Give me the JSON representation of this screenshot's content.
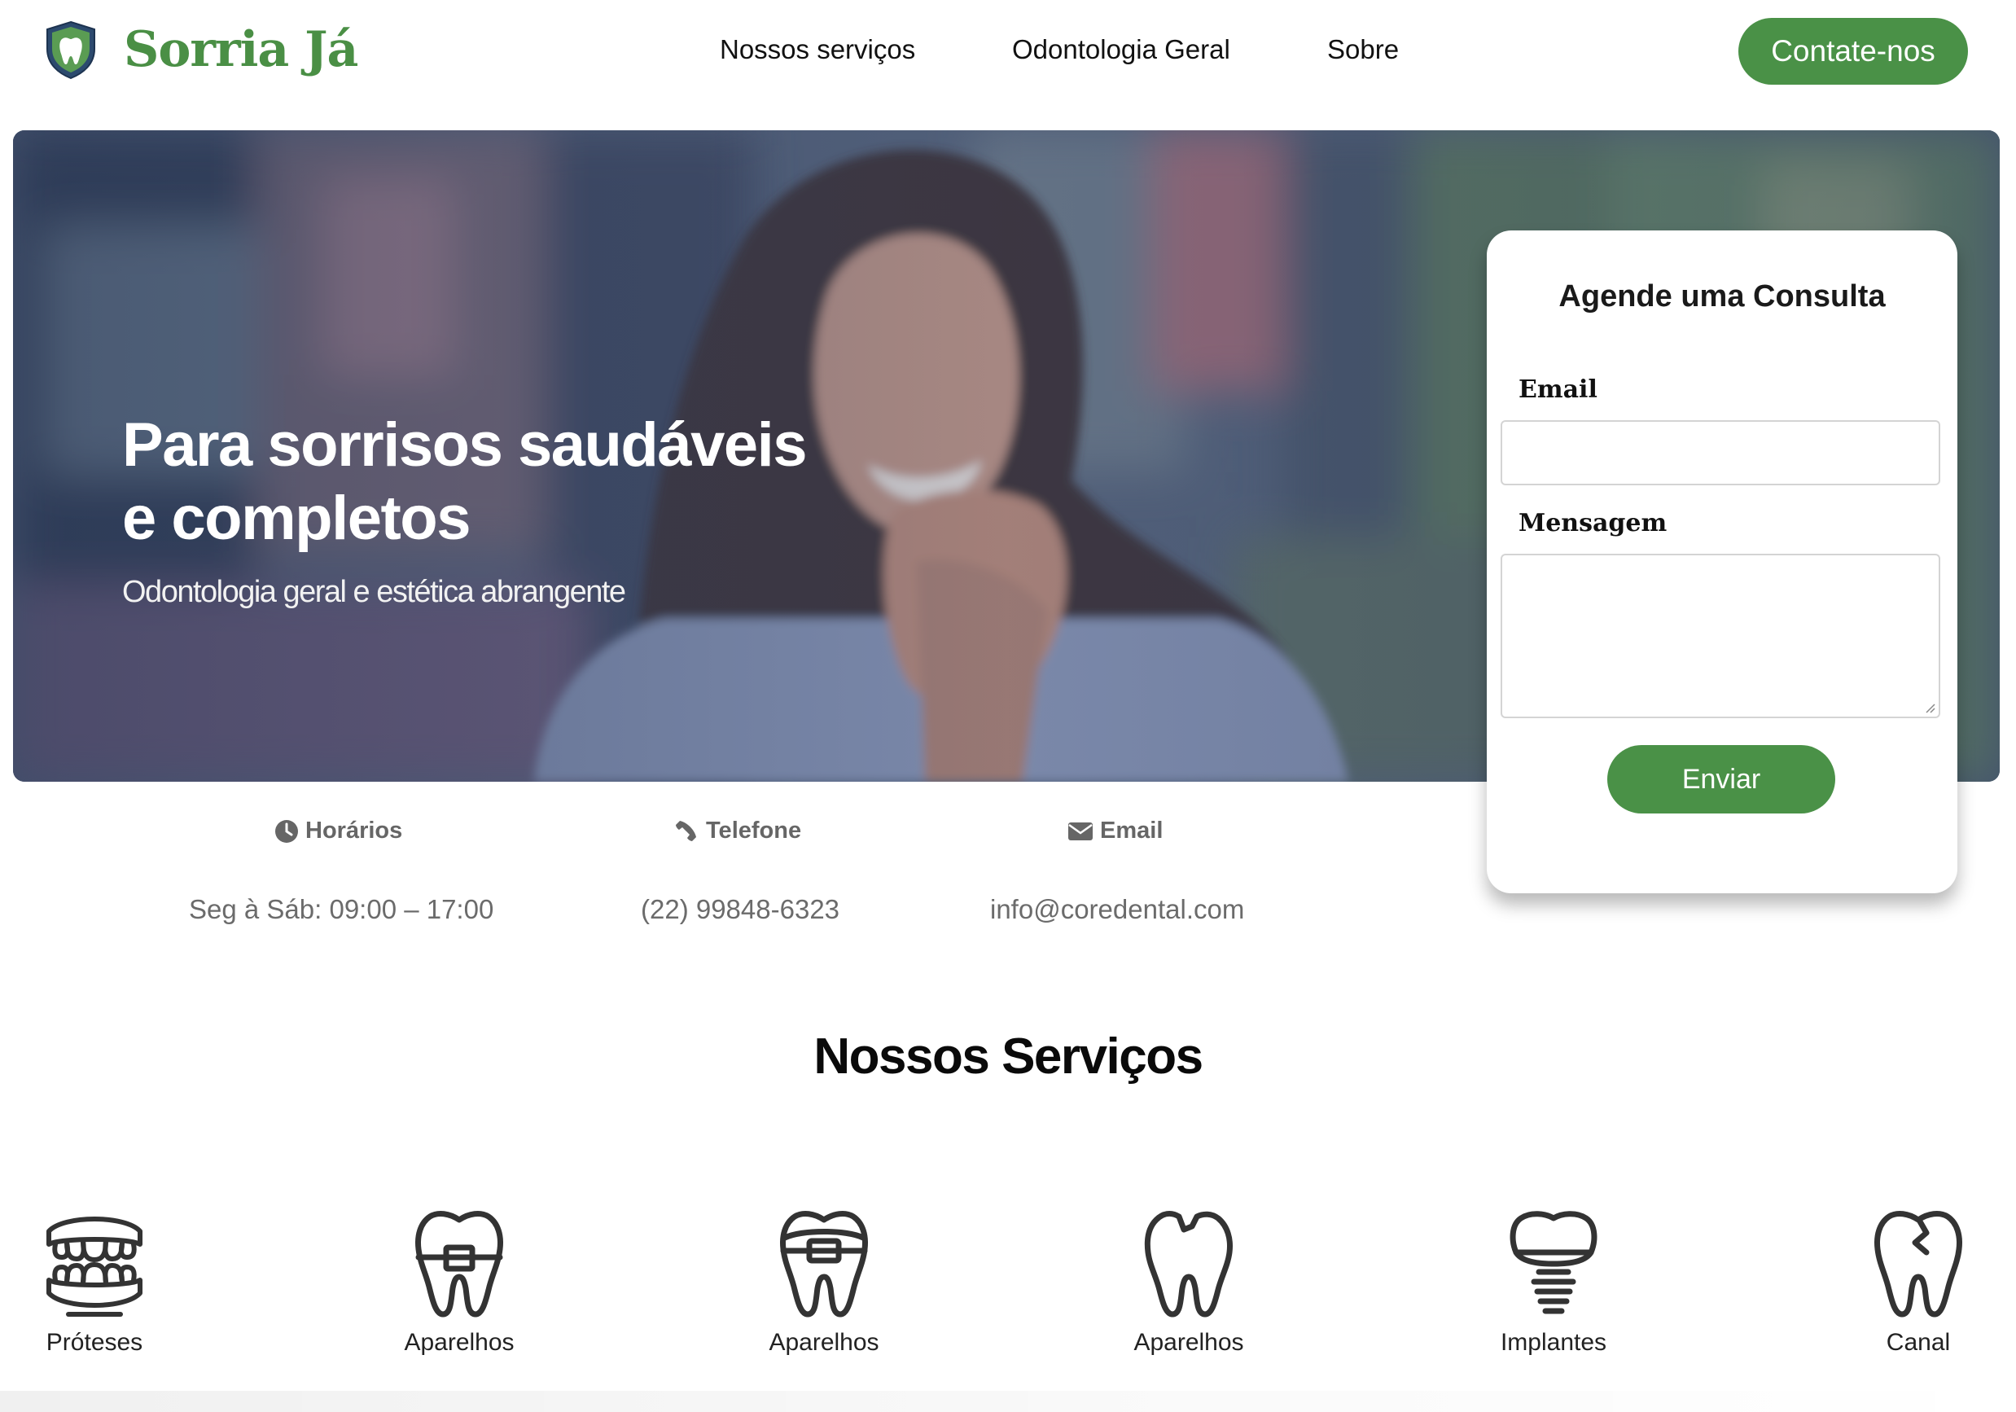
{
  "brand": {
    "name": "Sorria Já",
    "color": "#4a8f45",
    "icon": "tooth-shield-icon"
  },
  "nav": {
    "links": [
      "Nossos serviços",
      "Odontologia Geral",
      "Sobre"
    ],
    "cta": "Contate-nos"
  },
  "hero": {
    "title": "Para sorrisos saudáveis e completos",
    "subtitle": "Odontologia geral e estética abrangente"
  },
  "form": {
    "title": "Agende uma Consulta",
    "email_label": "Email",
    "email_value": "",
    "message_label": "Mensagem",
    "message_value": "",
    "submit": "Enviar"
  },
  "info": [
    {
      "icon": "clock-icon",
      "title": "Horários",
      "value": "Seg à Sáb: 09:00 – 17:00"
    },
    {
      "icon": "phone-icon",
      "title": "Telefone",
      "value": "(22) 99848-6323"
    },
    {
      "icon": "envelope-icon",
      "title": "Email",
      "value": "info@coredental.com"
    }
  ],
  "services": {
    "title": "Nossos Serviços",
    "items": [
      {
        "icon": "dentures-icon",
        "label": "Próteses"
      },
      {
        "icon": "tooth-braces-icon",
        "label": "Aparelhos"
      },
      {
        "icon": "tooth-braces-icon",
        "label": "Aparelhos"
      },
      {
        "icon": "chipped-tooth-icon",
        "label": "Aparelhos"
      },
      {
        "icon": "dental-implant-icon",
        "label": "Implantes"
      },
      {
        "icon": "cracked-tooth-icon",
        "label": "Canal"
      }
    ]
  },
  "colors": {
    "accent": "#4a9147",
    "hero_overlay": "#4d5a73"
  }
}
